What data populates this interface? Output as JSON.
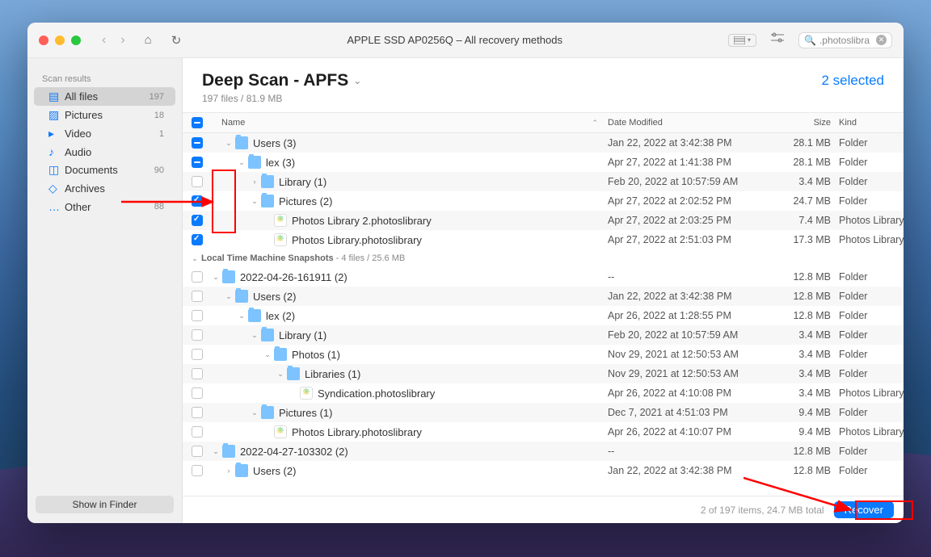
{
  "titlebar": {
    "title": "APPLE SSD AP0256Q – All recovery methods",
    "search_value": ".photoslibra"
  },
  "sidebar": {
    "header": "Scan results",
    "items": [
      {
        "label": "All files",
        "count": "197",
        "active": true
      },
      {
        "label": "Pictures",
        "count": "18",
        "active": false
      },
      {
        "label": "Video",
        "count": "1",
        "active": false
      },
      {
        "label": "Audio",
        "count": "",
        "active": false
      },
      {
        "label": "Documents",
        "count": "90",
        "active": false
      },
      {
        "label": "Archives",
        "count": "",
        "active": false
      },
      {
        "label": "Other",
        "count": "88",
        "active": false
      }
    ],
    "show_in_finder": "Show in Finder"
  },
  "main": {
    "title": "Deep Scan - APFS",
    "selected": "2 selected",
    "subtitle": "197 files / 81.9 MB",
    "columns": {
      "name": "Name",
      "date": "Date Modified",
      "size": "Size",
      "kind": "Kind"
    },
    "footer_text": "2 of 197 items, 24.7 MB total",
    "recover_label": "Recover"
  },
  "snapshots_section": {
    "label": "Local Time Machine Snapshots",
    "meta": "- 4 files / 25.6 MB"
  },
  "rows": [
    {
      "chk": "mixed",
      "indent": 1,
      "disclose": "open",
      "icon": "folder",
      "name": "Users (3)",
      "date": "Jan 22, 2022 at 3:42:38 PM",
      "size": "28.1 MB",
      "kind": "Folder"
    },
    {
      "chk": "mixed",
      "indent": 2,
      "disclose": "open",
      "icon": "folder",
      "name": "lex (3)",
      "date": "Apr 27, 2022 at 1:41:38 PM",
      "size": "28.1 MB",
      "kind": "Folder"
    },
    {
      "chk": "none",
      "indent": 3,
      "disclose": "closed",
      "icon": "folder",
      "name": "Library (1)",
      "date": "Feb 20, 2022 at 10:57:59 AM",
      "size": "3.4 MB",
      "kind": "Folder"
    },
    {
      "chk": "checked",
      "indent": 3,
      "disclose": "open",
      "icon": "folder",
      "name": "Pictures (2)",
      "date": "Apr 27, 2022 at 2:02:52 PM",
      "size": "24.7 MB",
      "kind": "Folder"
    },
    {
      "chk": "checked",
      "indent": 4,
      "disclose": "",
      "icon": "photos",
      "name": "Photos Library 2.photoslibrary",
      "date": "Apr 27, 2022 at 2:03:25 PM",
      "size": "7.4 MB",
      "kind": "Photos Library"
    },
    {
      "chk": "checked",
      "indent": 4,
      "disclose": "",
      "icon": "photos",
      "name": "Photos Library.photoslibrary",
      "date": "Apr 27, 2022 at 2:51:03 PM",
      "size": "17.3 MB",
      "kind": "Photos Library"
    }
  ],
  "rows2": [
    {
      "chk": "none",
      "indent": 0,
      "disclose": "open",
      "icon": "folder",
      "name": "2022-04-26-161911 (2)",
      "date": "--",
      "size": "12.8 MB",
      "kind": "Folder"
    },
    {
      "chk": "none",
      "indent": 1,
      "disclose": "open",
      "icon": "folder",
      "name": "Users (2)",
      "date": "Jan 22, 2022 at 3:42:38 PM",
      "size": "12.8 MB",
      "kind": "Folder"
    },
    {
      "chk": "none",
      "indent": 2,
      "disclose": "open",
      "icon": "folder",
      "name": "lex (2)",
      "date": "Apr 26, 2022 at 1:28:55 PM",
      "size": "12.8 MB",
      "kind": "Folder"
    },
    {
      "chk": "none",
      "indent": 3,
      "disclose": "open",
      "icon": "folder",
      "name": "Library (1)",
      "date": "Feb 20, 2022 at 10:57:59 AM",
      "size": "3.4 MB",
      "kind": "Folder"
    },
    {
      "chk": "none",
      "indent": 4,
      "disclose": "open",
      "icon": "folder",
      "name": "Photos (1)",
      "date": "Nov 29, 2021 at 12:50:53 AM",
      "size": "3.4 MB",
      "kind": "Folder"
    },
    {
      "chk": "none",
      "indent": 5,
      "disclose": "open",
      "icon": "folder",
      "name": "Libraries (1)",
      "date": "Nov 29, 2021 at 12:50:53 AM",
      "size": "3.4 MB",
      "kind": "Folder"
    },
    {
      "chk": "none",
      "indent": 6,
      "disclose": "",
      "icon": "photos",
      "name": "Syndication.photoslibrary",
      "date": "Apr 26, 2022 at 4:10:08 PM",
      "size": "3.4 MB",
      "kind": "Photos Library"
    },
    {
      "chk": "none",
      "indent": 3,
      "disclose": "open",
      "icon": "folder",
      "name": "Pictures (1)",
      "date": "Dec 7, 2021 at 4:51:03 PM",
      "size": "9.4 MB",
      "kind": "Folder"
    },
    {
      "chk": "none",
      "indent": 4,
      "disclose": "",
      "icon": "photos",
      "name": "Photos Library.photoslibrary",
      "date": "Apr 26, 2022 at 4:10:07 PM",
      "size": "9.4 MB",
      "kind": "Photos Library"
    },
    {
      "chk": "none",
      "indent": 0,
      "disclose": "open",
      "icon": "folder",
      "name": "2022-04-27-103302 (2)",
      "date": "--",
      "size": "12.8 MB",
      "kind": "Folder"
    },
    {
      "chk": "none",
      "indent": 1,
      "disclose": "closed",
      "icon": "folder",
      "name": "Users (2)",
      "date": "Jan 22, 2022 at 3:42:38 PM",
      "size": "12.8 MB",
      "kind": "Folder"
    }
  ]
}
